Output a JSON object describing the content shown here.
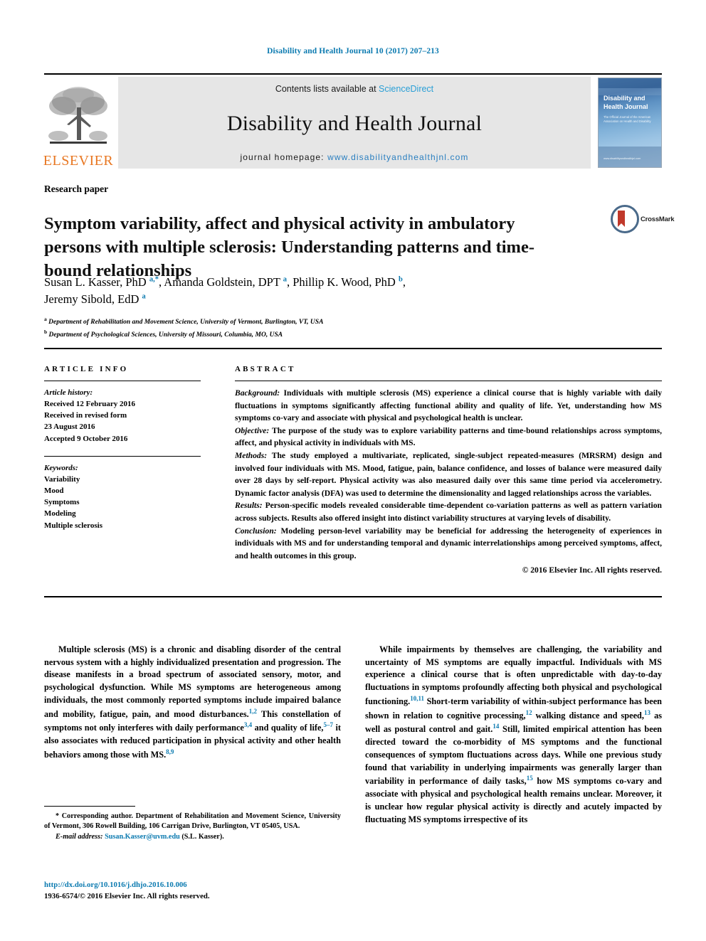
{
  "running_head": "Disability and Health Journal 10 (2017) 207–213",
  "masthead": {
    "publisher_name": "ELSEVIER",
    "publisher_logo_icon": "elsevier-tree-icon",
    "contents_prefix": "Contents lists available at ",
    "contents_link": "ScienceDirect",
    "journal_title": "Disability and Health Journal",
    "homepage_prefix": "journal homepage: ",
    "homepage_url": "www.disabilityandhealthjnl.com",
    "cover": {
      "title_line1": "Disability and",
      "title_line2": "Health Journal",
      "subtitle": "The Official Journal of the American Association on Health and Disability",
      "footer": "www.disabilityandhealthjnl.com"
    }
  },
  "article": {
    "type_label": "Research paper",
    "title": "Symptom variability, affect and physical activity in ambulatory persons with multiple sclerosis: Understanding patterns and time-bound relationships",
    "crossmark_label": "CrossMark",
    "authors_line1_a": "Susan L. Kasser, PhD ",
    "authors_sup1": "a,",
    "authors_sup1b": "*",
    "authors_line1_b": ", Amanda Goldstein, DPT ",
    "authors_sup2": "a",
    "authors_line1_c": ", Phillip K. Wood, PhD ",
    "authors_sup3": "b",
    "authors_line1_d": ",",
    "authors_line2": "Jeremy Sibold, EdD ",
    "authors_sup4": "a",
    "affiliation_a_marker": "a",
    "affiliation_a": " Department of Rehabilitation and Movement Science, University of Vermont, Burlington, VT, USA",
    "affiliation_b_marker": "b",
    "affiliation_b": " Department of Psychological Sciences, University of Missouri, Columbia, MO, USA"
  },
  "article_info": {
    "heading": "ARTICLE INFO",
    "history_label": "Article history:",
    "history_lines": [
      "Received 12 February 2016",
      "Received in revised form",
      "23 August 2016",
      "Accepted 9 October 2016"
    ],
    "keywords_label": "Keywords:",
    "keywords": [
      "Variability",
      "Mood",
      "Symptoms",
      "Modeling",
      "Multiple sclerosis"
    ]
  },
  "abstract": {
    "heading": "ABSTRACT",
    "sections": [
      {
        "label": "Background:",
        "text": " Individuals with multiple sclerosis (MS) experience a clinical course that is highly variable with daily fluctuations in symptoms significantly affecting functional ability and quality of life. Yet, understanding how MS symptoms co-vary and associate with physical and psychological health is unclear."
      },
      {
        "label": "Objective:",
        "text": " The purpose of the study was to explore variability patterns and time-bound relationships across symptoms, affect, and physical activity in individuals with MS."
      },
      {
        "label": "Methods:",
        "text": " The study employed a multivariate, replicated, single-subject repeated-measures (MRSRM) design and involved four individuals with MS. Mood, fatigue, pain, balance confidence, and losses of balance were measured daily over 28 days by self-report. Physical activity was also measured daily over this same time period via accelerometry. Dynamic factor analysis (DFA) was used to determine the dimensionality and lagged relationships across the variables."
      },
      {
        "label": "Results:",
        "text": " Person-specific models revealed considerable time-dependent co-variation patterns as well as pattern variation across subjects. Results also offered insight into distinct variability structures at varying levels of disability."
      },
      {
        "label": "Conclusion:",
        "text": " Modeling person-level variability may be beneficial for addressing the heterogeneity of experiences in individuals with MS and for understanding temporal and dynamic interrelationships among perceived symptoms, affect, and health outcomes in this group."
      }
    ],
    "copyright": "© 2016 Elsevier Inc. All rights reserved."
  },
  "body": {
    "left_column": {
      "part1": "Multiple sclerosis (MS) is a chronic and disabling disorder of the central nervous system with a highly individualized presentation and progression. The disease manifests in a broad spectrum of associated sensory, motor, and psychological dysfunction. While MS symptoms are heterogeneous among individuals, the most commonly reported symptoms include impaired balance and mobility, fatigue, pain, and mood disturbances.",
      "ref1": "1,2",
      "part2": " This constellation of symptoms not only interferes with daily performance",
      "ref2": "3,4",
      "part3": " and quality of life,",
      "ref3": "5–7",
      "part4": " it also associates with reduced participation in physical activity and other health behaviors among those with MS.",
      "ref4": "8,9"
    },
    "right_column": {
      "part1": "While impairments by themselves are challenging, the variability and uncertainty of MS symptoms are equally impactful. Individuals with MS experience a clinical course that is often unpredictable with day-to-day fluctuations in symptoms profoundly affecting both physical and psychological functioning.",
      "ref1": "10,11",
      "part2": " Short-term variability of within-subject performance has been shown in relation to cognitive processing,",
      "ref2": "12",
      "part3": " walking distance and speed,",
      "ref3": "13",
      "part4": " as well as postural control and gait.",
      "ref4": "14",
      "part5": " Still, limited empirical attention has been directed toward the co-morbidity of MS symptoms and the functional consequences of symptom fluctuations across days. While one previous study found that variability in underlying impairments was generally larger than variability in performance of daily tasks,",
      "ref5": "15",
      "part6": " how MS symptoms co-vary and associate with physical and psychological health remains unclear. Moreover, it is unclear how regular physical activity is directly and acutely impacted by fluctuating MS symptoms irrespective of its"
    }
  },
  "footnotes": {
    "corresponding_marker": "*",
    "corresponding_text": " Corresponding author. Department of Rehabilitation and Movement Science, University of Vermont, 306 Rowell Building, 106 Carrigan Drive, Burlington, VT 05405, USA.",
    "email_label": "E-mail address:",
    "email_address": "Susan.Kasser@uvm.edu",
    "email_owner": " (S.L. Kasser).",
    "doi": "http://dx.doi.org/10.1016/j.dhjo.2016.10.006",
    "issn_line": "1936-6574/© 2016 Elsevier Inc. All rights reserved."
  },
  "colors": {
    "link_blue": "#0b7ab0",
    "science_direct_blue": "#2a9fd6",
    "elsevier_orange": "#e87722",
    "masthead_grey": "#e6e6e6"
  }
}
